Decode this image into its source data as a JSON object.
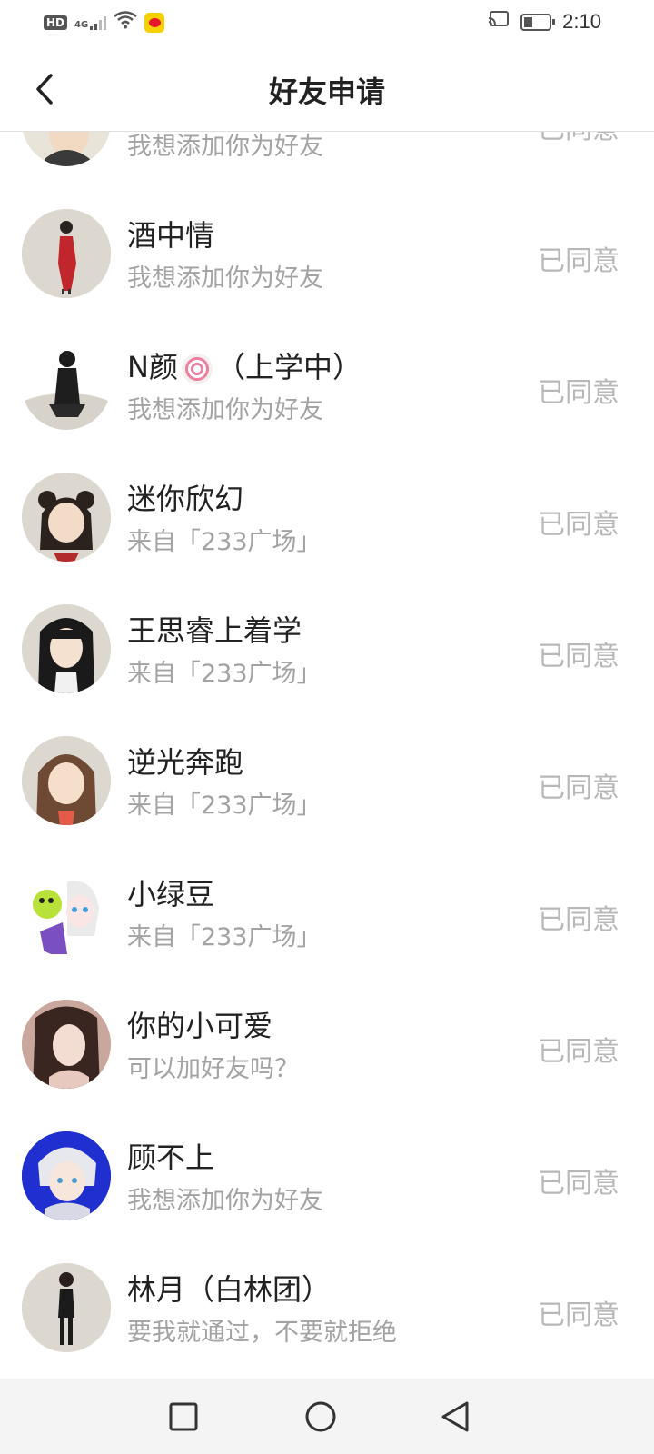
{
  "status_bar": {
    "hd": "HD",
    "network": "4G",
    "time": "2:10",
    "icons": [
      "hd-icon",
      "signal-icon",
      "wifi-icon",
      "weibo-icon",
      "cast-icon",
      "battery-icon"
    ]
  },
  "header": {
    "title": "好友申请",
    "back_icon": "chevron-left-icon"
  },
  "friend_requests": [
    {
      "name": "",
      "message": "我想添加你为好友",
      "status": "已同意"
    },
    {
      "name": "酒中情",
      "message": "我想添加你为好友",
      "status": "已同意"
    },
    {
      "name_prefix": "N颜",
      "name_suffix": "（上学中）",
      "name_emoji": "lollipop-emoji",
      "message": "我想添加你为好友",
      "status": "已同意"
    },
    {
      "name": "迷你欣幻",
      "message": "来自「233广场」",
      "status": "已同意"
    },
    {
      "name": "王思睿上着学",
      "message": "来自「233广场」",
      "status": "已同意"
    },
    {
      "name": "逆光奔跑",
      "message": "来自「233广场」",
      "status": "已同意"
    },
    {
      "name": "小绿豆",
      "message": "来自「233广场」",
      "status": "已同意"
    },
    {
      "name": "你的小可爱",
      "message": "可以加好友吗？",
      "status": "已同意"
    },
    {
      "name": "顾不上",
      "message": "我想添加你为好友",
      "status": "已同意"
    },
    {
      "name": "林月（白林团）",
      "message": "要我就通过，不要就拒绝",
      "status": "已同意"
    }
  ],
  "nav_bar": {
    "buttons": [
      "recents-square-icon",
      "home-circle-icon",
      "back-triangle-icon"
    ]
  },
  "colors": {
    "status_text": "#b8b8b8",
    "message_text": "#a3a3a3",
    "name_text": "#222222",
    "avatar_bg": "#dcdad3"
  }
}
